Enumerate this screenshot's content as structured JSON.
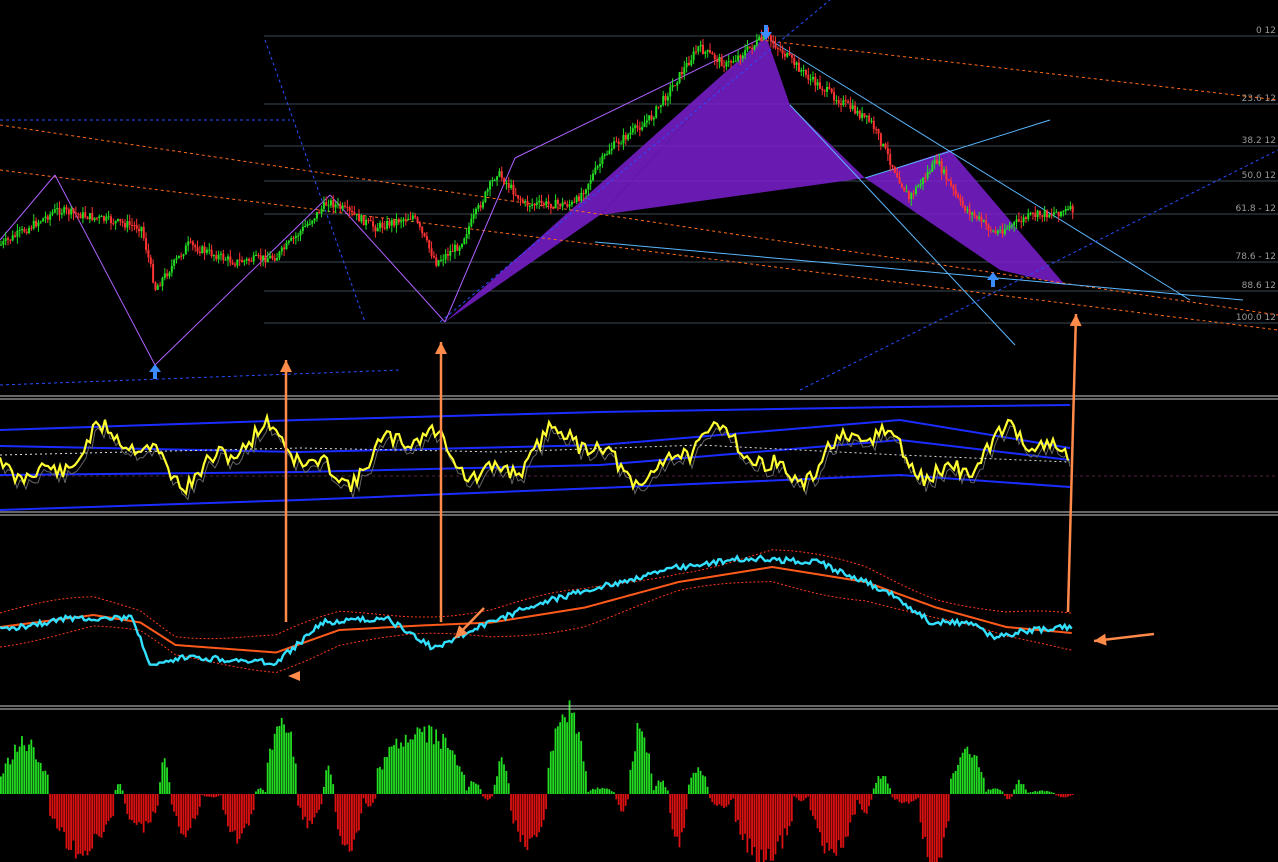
{
  "colors": {
    "background": "#000000",
    "bull_candle": "#22dd22",
    "bear_candle": "#ff3333",
    "pattern_fill": "#7a1fd0",
    "fib_line": "#3b4a55",
    "channel_line": "#4aa8ff",
    "trend_line": "#ff6a1a",
    "rsi_line": "#ffff33",
    "rsi_band": "#1a2cff",
    "fast_line": "#33e0ff",
    "slow_line": "#ff5a1a",
    "hist_pos": "#22dd22",
    "hist_neg": "#dd1111",
    "arrow": "#ff8a4a",
    "pivot_marker": "#3a8cff",
    "separator": "#cccccc"
  },
  "icons": {
    "pivot_low": "up-arrow-icon",
    "pivot_high": "down-arrow-icon"
  },
  "fib_labels": [
    "0 12",
    "23.6 12",
    "38.2 12",
    "50.0 12",
    "61.8 - 12",
    "78.6 - 12",
    "88.6 12",
    "100.0 12"
  ],
  "chart_data": [
    {
      "type": "candlestick",
      "panel": "price",
      "title": "",
      "fib_levels": [
        0,
        23.6,
        38.2,
        50.0,
        61.8,
        78.6,
        88.6,
        100.0
      ],
      "pattern": "harmonic",
      "pivots": [
        {
          "kind": "low",
          "bar": 65
        },
        {
          "kind": "high",
          "bar": 327
        },
        {
          "kind": "low",
          "bar": 425
        }
      ],
      "price_path": [
        [
          0,
          0.72
        ],
        [
          24,
          0.6
        ],
        [
          60,
          0.66
        ],
        [
          66,
          0.87
        ],
        [
          80,
          0.72
        ],
        [
          100,
          0.78
        ],
        [
          118,
          0.76
        ],
        [
          140,
          0.57
        ],
        [
          160,
          0.66
        ],
        [
          176,
          0.62
        ],
        [
          186,
          0.78
        ],
        [
          196,
          0.72
        ],
        [
          212,
          0.47
        ],
        [
          224,
          0.58
        ],
        [
          245,
          0.58
        ],
        [
          260,
          0.39
        ],
        [
          278,
          0.28
        ],
        [
          298,
          0.04
        ],
        [
          310,
          0.1
        ],
        [
          327,
          0.0
        ],
        [
          346,
          0.15
        ],
        [
          372,
          0.3
        ],
        [
          388,
          0.56
        ],
        [
          400,
          0.43
        ],
        [
          410,
          0.58
        ],
        [
          425,
          0.68
        ],
        [
          440,
          0.62
        ],
        [
          458,
          0.6
        ]
      ]
    },
    {
      "type": "line",
      "panel": "oscillator",
      "series": [
        {
          "color": "yellow",
          "seed": 3
        }
      ],
      "bands": 3
    },
    {
      "type": "line",
      "panel": "averages",
      "fast_path": [
        [
          0,
          0.6
        ],
        [
          30,
          0.52
        ],
        [
          56,
          0.52
        ],
        [
          65,
          0.85
        ],
        [
          80,
          0.78
        ],
        [
          118,
          0.82
        ],
        [
          138,
          0.55
        ],
        [
          165,
          0.52
        ],
        [
          185,
          0.72
        ],
        [
          205,
          0.58
        ],
        [
          230,
          0.42
        ],
        [
          260,
          0.3
        ],
        [
          290,
          0.18
        ],
        [
          320,
          0.12
        ],
        [
          350,
          0.15
        ],
        [
          380,
          0.35
        ],
        [
          398,
          0.55
        ],
        [
          415,
          0.55
        ],
        [
          425,
          0.65
        ],
        [
          440,
          0.6
        ],
        [
          458,
          0.58
        ]
      ],
      "slow_path": [
        [
          0,
          0.58
        ],
        [
          40,
          0.5
        ],
        [
          60,
          0.55
        ],
        [
          75,
          0.7
        ],
        [
          118,
          0.75
        ],
        [
          145,
          0.6
        ],
        [
          180,
          0.57
        ],
        [
          210,
          0.55
        ],
        [
          250,
          0.45
        ],
        [
          290,
          0.28
        ],
        [
          330,
          0.18
        ],
        [
          370,
          0.28
        ],
        [
          400,
          0.45
        ],
        [
          430,
          0.58
        ],
        [
          458,
          0.62
        ]
      ]
    },
    {
      "type": "bar",
      "panel": "histogram",
      "segments": [
        [
          0,
          20,
          0.8
        ],
        [
          21,
          48,
          -0.9
        ],
        [
          49,
          52,
          0.2
        ],
        [
          53,
          67,
          -0.55
        ],
        [
          68,
          72,
          0.6
        ],
        [
          73,
          85,
          -0.6
        ],
        [
          86,
          94,
          -0.05
        ],
        [
          95,
          108,
          -0.7
        ],
        [
          109,
          113,
          0.1
        ],
        [
          114,
          126,
          1.3
        ],
        [
          127,
          137,
          -0.5
        ],
        [
          138,
          142,
          0.4
        ],
        [
          143,
          154,
          -1.0
        ],
        [
          155,
          160,
          -0.2
        ],
        [
          161,
          198,
          1.05
        ],
        [
          199,
          205,
          0.2
        ],
        [
          206,
          210,
          -0.1
        ],
        [
          211,
          217,
          0.5
        ],
        [
          218,
          233,
          -0.85
        ],
        [
          234,
          250,
          1.3
        ],
        [
          251,
          262,
          0.1
        ],
        [
          263,
          268,
          -0.25
        ],
        [
          269,
          278,
          1.05
        ],
        [
          279,
          285,
          0.2
        ],
        [
          286,
          293,
          -0.8
        ],
        [
          294,
          302,
          0.4
        ],
        [
          303,
          313,
          -0.2
        ],
        [
          314,
          338,
          -1.1
        ],
        [
          339,
          345,
          -0.1
        ],
        [
          346,
          365,
          -0.9
        ],
        [
          366,
          372,
          -0.3
        ],
        [
          373,
          380,
          0.3
        ],
        [
          381,
          392,
          -0.15
        ],
        [
          393,
          405,
          -1.2
        ],
        [
          406,
          420,
          0.7
        ],
        [
          421,
          428,
          0.1
        ],
        [
          429,
          432,
          -0.1
        ],
        [
          433,
          438,
          0.2
        ],
        [
          439,
          450,
          0.05
        ],
        [
          451,
          458,
          -0.05
        ]
      ]
    }
  ]
}
